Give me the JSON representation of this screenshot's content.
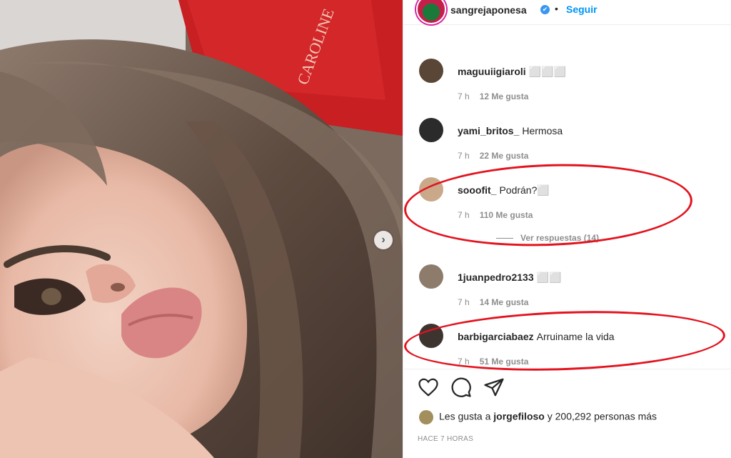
{
  "post": {
    "username": "sangrejaponesa",
    "verified_badge": "✔",
    "separator": "•",
    "follow_label": "Seguir",
    "next_icon": "›",
    "book_title": "CAROLINE"
  },
  "comments": [
    {
      "user": "maguuiigiaroli",
      "text": "⬜⬜⬜",
      "time": "7 h",
      "likes": "12 Me gusta"
    },
    {
      "user": "yami_britos_",
      "text": "Hermosa",
      "time": "7 h",
      "likes": "22 Me gusta"
    },
    {
      "user": "sooofit_",
      "text": "Podrán?⬜",
      "time": "7 h",
      "likes": "110 Me gusta",
      "replies": "Ver respuestas (14)"
    },
    {
      "user": "1juanpedro2133",
      "text": "⬜⬜",
      "time": "7 h",
      "likes": "14 Me gusta"
    },
    {
      "user": "barbigarciabaez",
      "text": "Arruiname la vida",
      "time": "7 h",
      "likes": "51 Me gusta"
    }
  ],
  "likes": {
    "prefix": "Les gusta a",
    "user": "jorgefiloso",
    "suffix": "y 200,292 personas más"
  },
  "timestamp": "HACE 7 HORAS",
  "colors": {
    "accent": "#0095f6",
    "annotation": "#e3131e",
    "text": "#262626",
    "muted": "#8e8e8e"
  }
}
